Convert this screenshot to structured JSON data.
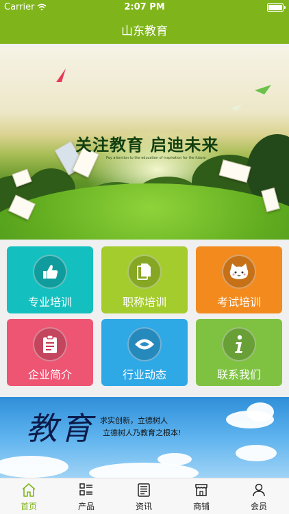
{
  "status_bar": {
    "carrier": "Carrier",
    "time": "2:07 PM"
  },
  "header": {
    "title": "山东教育"
  },
  "banner": {
    "headline": "关注教育 启迪未来",
    "subtitle": "Pay attention to the education of inspiration for the future"
  },
  "grid": [
    {
      "label": "专业培训",
      "color": "#14bfbf",
      "icon": "thumbs-up-icon"
    },
    {
      "label": "职称培训",
      "color": "#a4cc2d",
      "icon": "documents-icon"
    },
    {
      "label": "考试培训",
      "color": "#f28a1e",
      "icon": "cat-face-icon"
    },
    {
      "label": "企业简介",
      "color": "#ee5573",
      "icon": "clipboard-icon"
    },
    {
      "label": "行业动态",
      "color": "#2fa8e6",
      "icon": "eye-icon"
    },
    {
      "label": "联系我们",
      "color": "#7fc242",
      "icon": "info-icon"
    }
  ],
  "promo": {
    "big_text": "教育",
    "line1": "求实创新，立德树人",
    "line2": "立德树人乃教育之根本!"
  },
  "tabbar": {
    "active_color": "#7fb51b",
    "items": [
      {
        "label": "首页",
        "icon": "home-icon"
      },
      {
        "label": "产品",
        "icon": "product-list-icon"
      },
      {
        "label": "资讯",
        "icon": "news-icon"
      },
      {
        "label": "商铺",
        "icon": "store-icon"
      },
      {
        "label": "会员",
        "icon": "user-icon"
      }
    ]
  }
}
